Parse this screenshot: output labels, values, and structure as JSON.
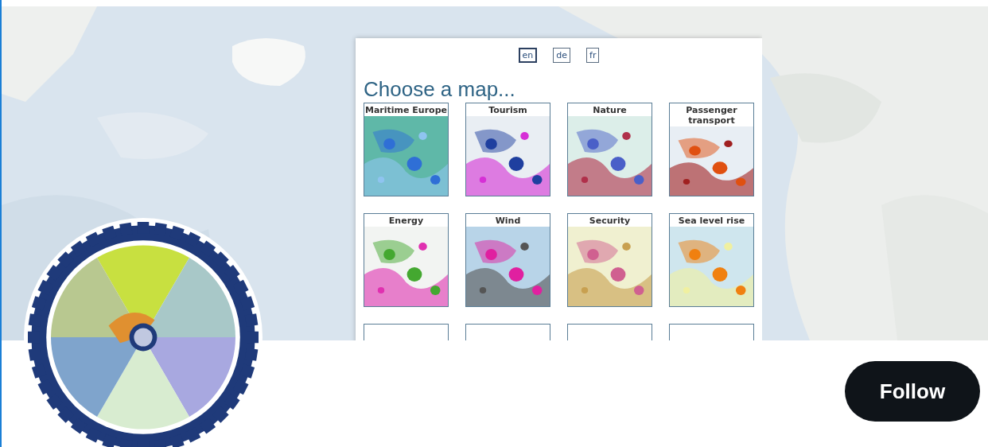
{
  "banner": {
    "kind": "picture",
    "map_chooser": {
      "languages": [
        {
          "label": "en",
          "selected": true
        },
        {
          "label": "de",
          "selected": false
        },
        {
          "label": "fr",
          "selected": false
        }
      ],
      "title": "Choose a map...",
      "maps": [
        {
          "title": "Maritime Europe"
        },
        {
          "title": "Tourism"
        },
        {
          "title": "Nature"
        },
        {
          "title": "Passenger transport"
        },
        {
          "title": "Energy"
        },
        {
          "title": "Wind"
        },
        {
          "title": "Security"
        },
        {
          "title": "Sea level rise"
        }
      ]
    }
  },
  "follow_button": {
    "label": "Follow"
  }
}
